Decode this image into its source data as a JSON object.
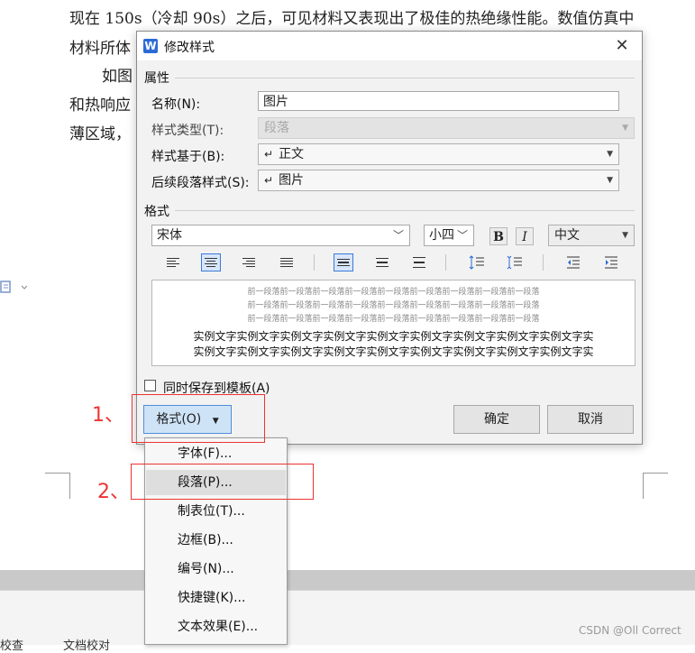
{
  "document": {
    "line1": "现在 150s（冷却 90s）之后，可见材料又表现出了极佳的热绝缘性能。数值仿真中",
    "line2": "材料所体",
    "line3": "如图",
    "line4": "和热响应",
    "line5": "薄区域，"
  },
  "dialog": {
    "app_icon_text": "W",
    "title": "修改样式",
    "close": "✕",
    "properties_section": "属性",
    "name_label": "名称(N):",
    "name_value": "图片",
    "style_type_label": "样式类型(T):",
    "style_type_value": "段落",
    "based_on_label": "样式基于(B):",
    "based_on_value": "正文",
    "next_style_label": "后续段落样式(S):",
    "next_style_value": "图片",
    "return_glyph": "↵",
    "format_section": "格式",
    "font_value": "宋体",
    "size_value": "小四",
    "bold": "B",
    "italic": "I",
    "lang_value": "中文",
    "preview_prev": "前一段落前一段落前一段落前一段落前一段落前一段落前一段落前一段落前一段落",
    "preview_sample": "实例文字实例文字实例文字实例文字实例文字实例文字实例文字实例文字实例文字实",
    "save_template_label": "同时保存到模板(A)",
    "format_button": "格式(O)",
    "ok": "确定",
    "cancel": "取消"
  },
  "menu": {
    "items": [
      "字体(F)...",
      "段落(P)...",
      "制表位(T)...",
      "边框(B)...",
      "编号(N)...",
      "快捷键(K)...",
      "文本效果(E)..."
    ]
  },
  "annotations": {
    "step1": "1、",
    "step2": "2、"
  },
  "statusbar": {
    "left_text": "校查",
    "doc_check": "文档校对"
  },
  "watermark": "CSDN @Oll Correct"
}
